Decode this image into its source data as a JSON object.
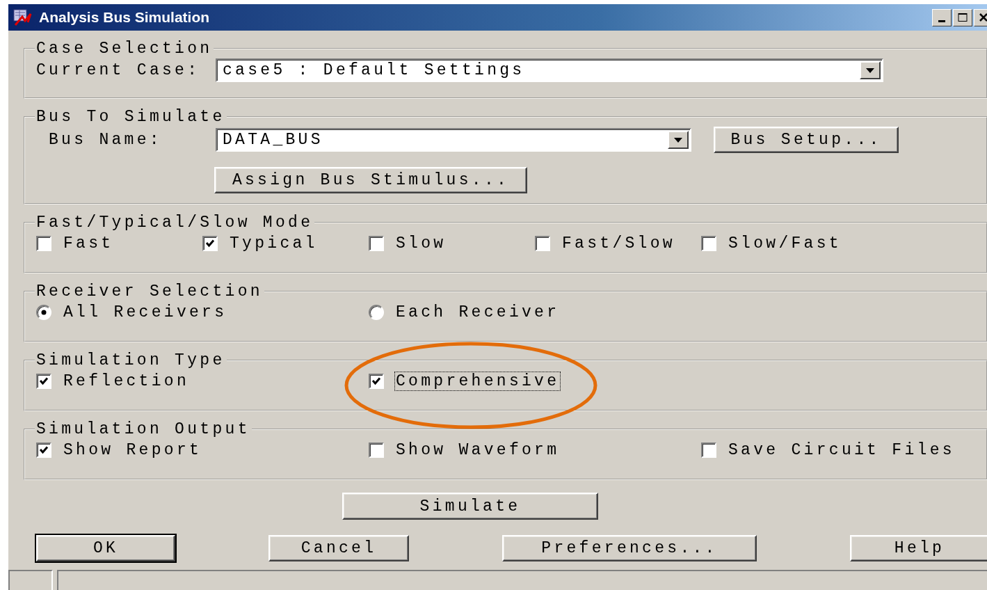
{
  "window": {
    "title": "Analysis Bus Simulation"
  },
  "groups": [
    {
      "kind": "case",
      "legend": "Case Selection",
      "label": "Current Case:",
      "value": "case5 : Default Settings"
    },
    {
      "kind": "bus",
      "legend": "Bus To Simulate",
      "label": "Bus Name:",
      "value": "DATA_BUS",
      "setup_button": "Bus Setup...",
      "stimulus_button": "Assign Bus Stimulus..."
    },
    {
      "kind": "checkboxes",
      "legend": "Fast/Typical/Slow Mode",
      "options": [
        {
          "label": "Fast",
          "checked": false
        },
        {
          "label": "Typical",
          "checked": true
        },
        {
          "label": "Slow",
          "checked": false
        },
        {
          "label": "Fast/Slow",
          "checked": false
        },
        {
          "label": "Slow/Fast",
          "checked": false
        }
      ]
    },
    {
      "kind": "radios",
      "legend": "Receiver Selection",
      "options": [
        {
          "label": "All Receivers",
          "selected": true
        },
        {
          "label": "Each Receiver",
          "selected": false
        }
      ]
    },
    {
      "kind": "checkboxes",
      "legend": "Simulation Type",
      "options": [
        {
          "label": "Reflection",
          "checked": true,
          "focused": false,
          "circled": false
        },
        {
          "label": "Comprehensive",
          "checked": true,
          "focused": true,
          "circled": true
        }
      ]
    },
    {
      "kind": "checkboxes",
      "legend": "Simulation Output",
      "options": [
        {
          "label": "Show Report",
          "checked": true
        },
        {
          "label": "Show Waveform",
          "checked": false
        },
        {
          "label": "Save Circuit Files",
          "checked": false
        }
      ]
    }
  ],
  "simulate_button": "Simulate",
  "buttons": [
    {
      "label": "OK",
      "default": true
    },
    {
      "label": "Cancel",
      "default": false
    },
    {
      "label": "Preferences...",
      "default": false
    },
    {
      "label": "Help",
      "default": false
    }
  ]
}
